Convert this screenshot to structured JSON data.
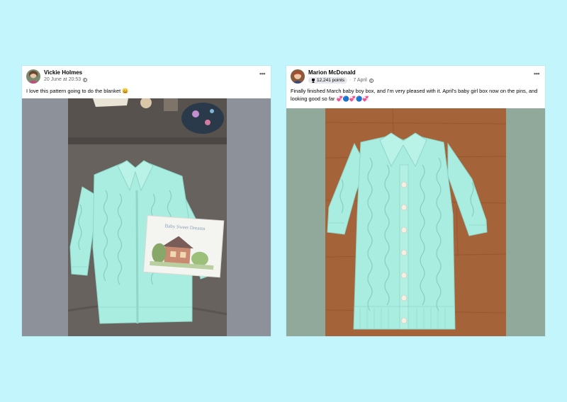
{
  "page": {
    "background": "#c2f6fc"
  },
  "posts": [
    {
      "author": "Vickie Holmes",
      "date": "20 June at 20:53",
      "privacy_icon": "globe-icon",
      "more_label": "•••",
      "text": "I love this pattern going to do the blanket 😀",
      "image_subject": "mint-green cable knit baby cardigan on grey sofa with pattern book",
      "book_title": "Baby Sweet Dreams"
    },
    {
      "author": "Marion McDonald",
      "points_badge": "12,241 points",
      "badge_icon": "trophy-icon",
      "separator": "·",
      "date": "7 April",
      "privacy_icon": "globe-icon",
      "more_label": "•••",
      "text": "Finally finished March baby boy box, and I'm very pleased with it. April's baby girl box now on the pins, and looking good so far 💞🔵💞🔵💞",
      "image_subject": "mint-green cable knit baby cardigan on wooden table"
    }
  ],
  "colors": {
    "knit": "#a9ede0",
    "sofa": "#5f5b58",
    "wood": "#a5633a"
  }
}
